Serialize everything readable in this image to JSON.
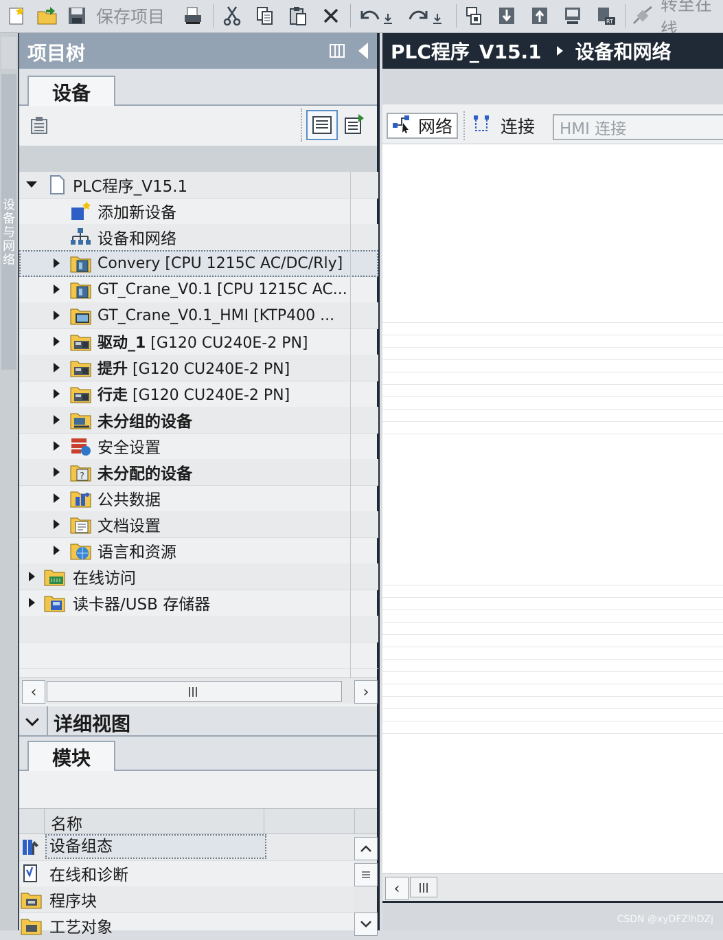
{
  "toolbar": {
    "save_project_label": "保存项目",
    "go_online_label": "转至在线"
  },
  "left_strip": {
    "label": "设备与网络"
  },
  "project_tree": {
    "title": "项目树",
    "tab_devices": "设备",
    "items": [
      {
        "label": "PLC程序_V15.1",
        "expand": "down",
        "icon": "project-icon",
        "bold": false
      },
      {
        "label": "添加新设备",
        "expand": "none",
        "icon": "add-device-icon",
        "bold": false
      },
      {
        "label": "设备和网络",
        "expand": "none",
        "icon": "network-icon",
        "bold": false
      },
      {
        "label": "Convery [CPU 1215C AC/DC/Rly]",
        "expand": "right",
        "icon": "plc-folder-icon",
        "bold": false,
        "selected": true
      },
      {
        "label": "GT_Crane_V0.1 [CPU 1215C AC...",
        "expand": "right",
        "icon": "plc-folder-icon",
        "bold": false
      },
      {
        "label": "GT_Crane_V0.1_HMI [KTP400 ...",
        "expand": "right",
        "icon": "hmi-folder-icon",
        "bold": false
      },
      {
        "label_bold": "驱动_1",
        "label": " [G120 CU240E-2 PN]",
        "expand": "right",
        "icon": "drive-folder-icon"
      },
      {
        "label_bold": "提升",
        "label": " [G120 CU240E-2 PN]",
        "expand": "right",
        "icon": "drive-folder-icon"
      },
      {
        "label_bold": "行走",
        "label": " [G120 CU240E-2 PN]",
        "expand": "right",
        "icon": "drive-folder-icon"
      },
      {
        "label": "未分组的设备",
        "expand": "right",
        "icon": "ungrouped-folder-icon",
        "bold": true
      },
      {
        "label": "安全设置",
        "expand": "right",
        "icon": "security-icon",
        "bold": false
      },
      {
        "label": "未分配的设备",
        "expand": "right",
        "icon": "unassigned-folder-icon",
        "bold": true
      },
      {
        "label": "公共数据",
        "expand": "right",
        "icon": "common-data-icon",
        "bold": false
      },
      {
        "label": "文档设置",
        "expand": "right",
        "icon": "document-settings-icon",
        "bold": false
      },
      {
        "label": "语言和资源",
        "expand": "right",
        "icon": "languages-icon",
        "bold": false
      },
      {
        "label": "在线访问",
        "expand": "right",
        "icon": "online-access-icon",
        "bold": false,
        "level": 0
      },
      {
        "label": "读卡器/USB 存储器",
        "expand": "right",
        "icon": "card-reader-icon",
        "bold": false,
        "level": 0
      }
    ]
  },
  "details_view": {
    "title": "详细视图",
    "tab_modules": "模块",
    "column_name": "名称",
    "rows": [
      {
        "label": "设备组态",
        "icon": "device-config-icon",
        "selected": true
      },
      {
        "label": "在线和诊断",
        "icon": "diagnostics-icon"
      },
      {
        "label": "程序块",
        "icon": "program-blocks-icon"
      },
      {
        "label": "工艺对象",
        "icon": "technology-objects-icon"
      }
    ]
  },
  "editor": {
    "breadcrumb_project": "PLC程序_V15.1",
    "breadcrumb_page": "设备和网络",
    "network_label": "网络",
    "connections_label": "连接",
    "hmi_connection_placeholder": "HMI 连接"
  },
  "watermark": "CSDN @xyDFZlhDZj",
  "colors": {
    "title_dark": "#1f2a36",
    "tree_header": "#94a3b3",
    "panel_bg": "#eef0f2"
  }
}
